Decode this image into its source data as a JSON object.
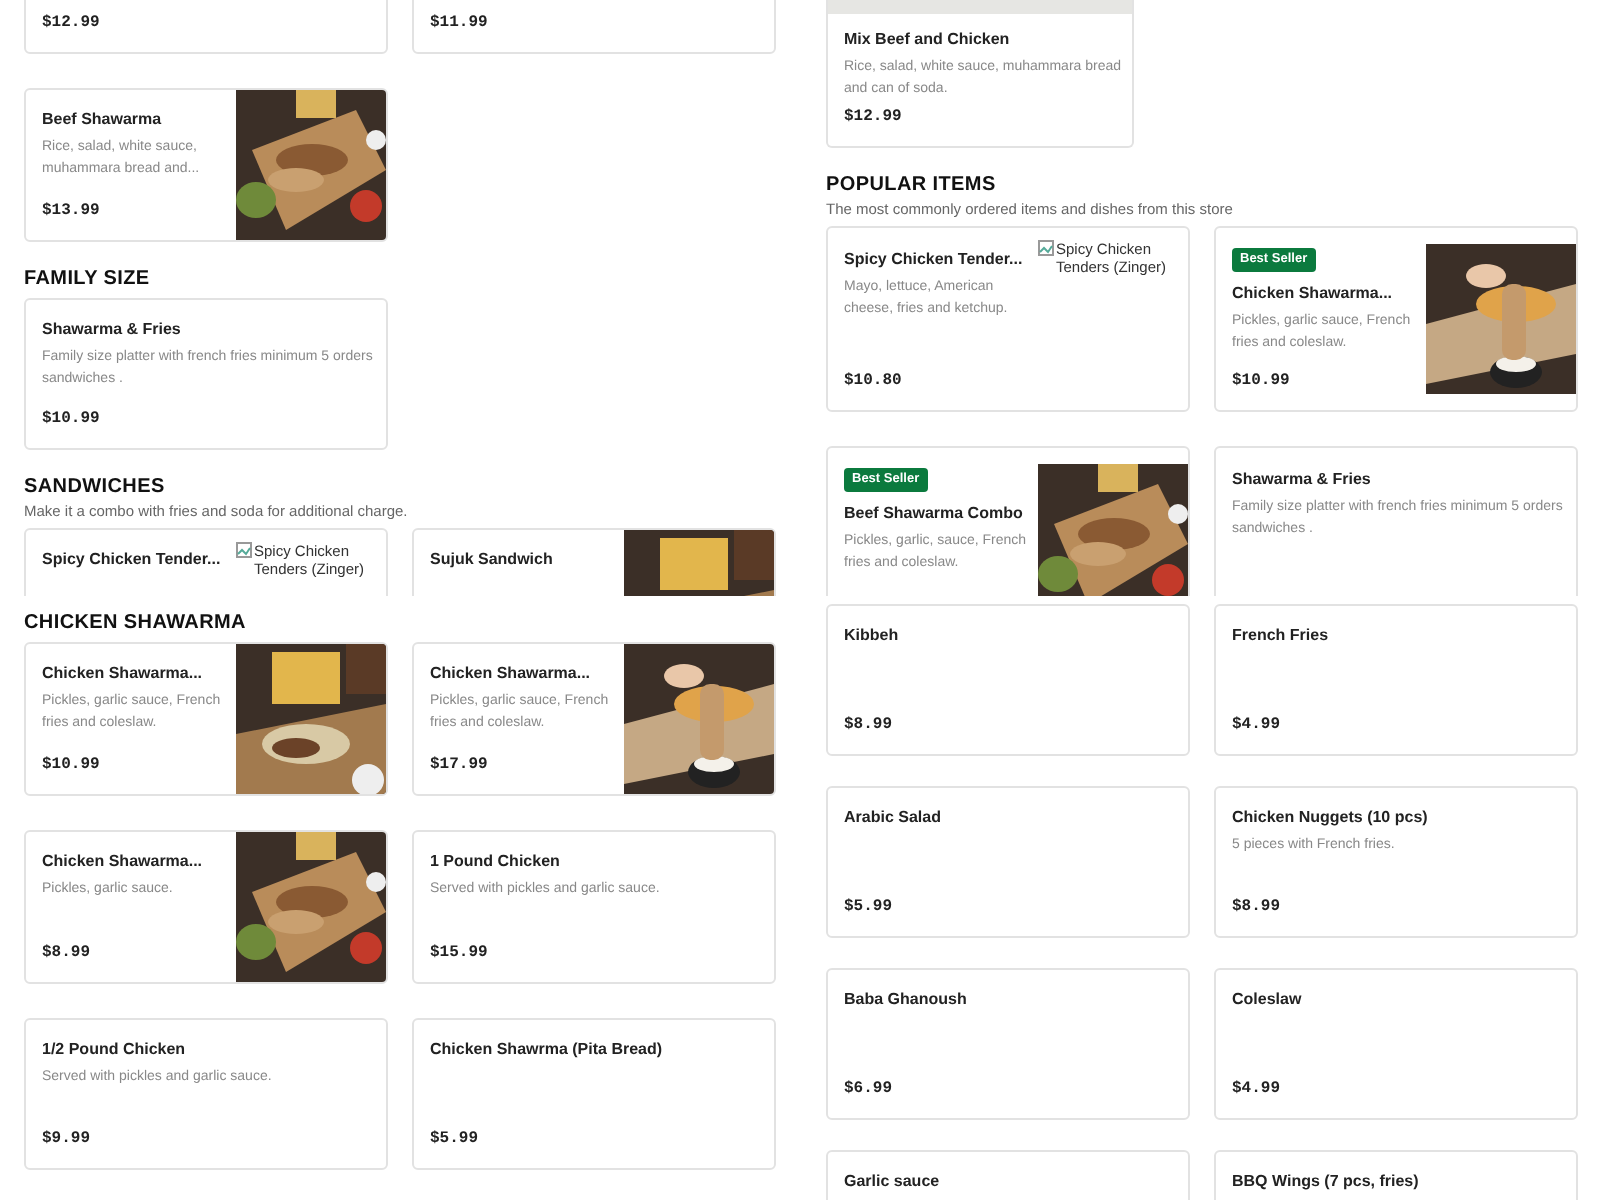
{
  "panels": [
    {
      "items": [
        {
          "kind": "cards",
          "cards": [
            {
              "kind": "plain",
              "price": "$12.99"
            },
            {
              "kind": "plain",
              "price": "$11.99"
            }
          ]
        },
        {
          "kind": "cards",
          "cards": [
            {
              "kind": "picture",
              "name": "Beef Shawarma",
              "description": "Rice, salad, white sauce, muhammara bread and...",
              "price": "$13.99"
            }
          ]
        },
        {
          "kind": "heading",
          "text": "FAMILY SIZE"
        },
        {
          "kind": "cards",
          "cards": [
            {
              "kind": "plain",
              "name": "Shawarma & Fries",
              "description": "Family size platter with french fries minimum 5 orders sandwiches .",
              "price": "$10.99"
            }
          ]
        },
        {
          "kind": "heading",
          "text": "SANDWICHES"
        },
        {
          "kind": "note",
          "text": "Make it a combo with fries and soda for additional charge."
        },
        {
          "kind": "cards",
          "cards": [
            {
              "kind": "alt",
              "name": "Spicy Chicken Tender...",
              "image_alt": "Spicy Chicken Tenders (Zinger)"
            },
            {
              "kind": "picture",
              "name": "Sujuk Sandwich"
            }
          ]
        }
      ]
    },
    {
      "items": [
        {
          "kind": "cards",
          "cards": [
            {
              "kind": "placeholder",
              "name": "Mix Beef and Chicken",
              "description": "Rice, salad, white sauce, muhammara bread and can of soda.",
              "price": "$12.99"
            }
          ]
        },
        {
          "kind": "heading",
          "text": "POPULAR ITEMS"
        },
        {
          "kind": "note",
          "text": "The most commonly ordered items and dishes from this store"
        },
        {
          "kind": "cards",
          "cards": [
            {
              "kind": "alt",
              "name": "Spicy Chicken Tender...",
              "description": "Mayo, lettuce, American cheese, fries and ketchup.",
              "price": "$10.80",
              "image_alt": "Spicy Chicken Tenders (Zinger)"
            },
            {
              "kind": "picture",
              "badge": "Best Seller",
              "name": "Chicken Shawarma...",
              "description": "Pickles, garlic sauce, French fries and coleslaw.",
              "price": "$10.99"
            }
          ]
        },
        {
          "kind": "cards",
          "cards": [
            {
              "kind": "picture",
              "badge": "Best Seller",
              "name": "Beef Shawarma Combo",
              "description": "Pickles, garlic, sauce, French fries and coleslaw."
            },
            {
              "kind": "plain",
              "name": "Shawarma & Fries",
              "description": "Family size platter with french fries minimum 5 orders sandwiches ."
            }
          ]
        }
      ]
    },
    {
      "items": [
        {
          "kind": "heading",
          "text": "CHICKEN SHAWARMA"
        },
        {
          "kind": "cards",
          "cards": [
            {
              "kind": "picture",
              "name": "Chicken Shawarma...",
              "description": "Pickles, garlic sauce, French fries and coleslaw.",
              "price": "$10.99"
            },
            {
              "kind": "picture",
              "name": "Chicken Shawarma...",
              "description": "Pickles, garlic sauce, French fries and coleslaw.",
              "price": "$17.99"
            }
          ]
        },
        {
          "kind": "cards",
          "cards": [
            {
              "kind": "picture",
              "name": "Chicken Shawarma...",
              "description": "Pickles, garlic sauce.",
              "price": "$8.99"
            },
            {
              "kind": "plain",
              "name": "1 Pound Chicken",
              "description": "Served with pickles and garlic sauce.",
              "price": "$15.99"
            }
          ]
        },
        {
          "kind": "cards",
          "cards": [
            {
              "kind": "plain",
              "name": "1/2 Pound Chicken",
              "description": "Served with pickles and garlic sauce.",
              "price": "$9.99"
            },
            {
              "kind": "plain",
              "name": "Chicken Shawrma (Pita Bread)",
              "price": "$5.99"
            }
          ]
        }
      ]
    },
    {
      "items": [
        {
          "kind": "cards",
          "cards": [
            {
              "kind": "plain",
              "name": "Kibbeh",
              "price": "$8.99"
            },
            {
              "kind": "plain",
              "name": "French Fries",
              "price": "$4.99"
            }
          ]
        },
        {
          "kind": "cards",
          "cards": [
            {
              "kind": "plain",
              "name": "Arabic Salad",
              "price": "$5.99"
            },
            {
              "kind": "plain",
              "name": "Chicken Nuggets (10 pcs)",
              "description": "5 pieces with French fries.",
              "price": "$8.99"
            }
          ]
        },
        {
          "kind": "cards",
          "cards": [
            {
              "kind": "plain",
              "name": "Baba Ghanoush",
              "price": "$6.99"
            },
            {
              "kind": "plain",
              "name": "Coleslaw",
              "price": "$4.99"
            }
          ]
        },
        {
          "kind": "cards",
          "cards": [
            {
              "kind": "plain",
              "name": "Garlic sauce"
            },
            {
              "kind": "plain",
              "name": "BBQ Wings (7 pcs, fries)"
            }
          ]
        }
      ]
    }
  ]
}
